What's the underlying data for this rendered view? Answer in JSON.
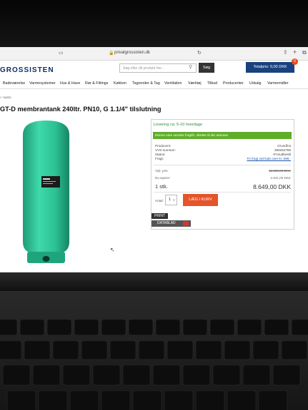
{
  "browser": {
    "url": "privatgrossisten.dk"
  },
  "header": {
    "logo": "GROSSISTEN",
    "search_placeholder": "Søg efter dit produkt her...",
    "search_button": "Søg",
    "cart_label": "Totalpris: 0,00 DKK",
    "cart_count": "0"
  },
  "nav": {
    "items": [
      "Badeværelse",
      "Varmesystemer",
      "Hus & Have",
      "Rør & Fittings",
      "Køkken",
      "Tagrender & Tag",
      "Ventilation",
      "Værktøj",
      "Tilbud",
      "Producenter",
      "Udsalg",
      "Varmemidler"
    ]
  },
  "breadcrumb": "< Hjælp",
  "product": {
    "title": "GT-D membrantank 240ltr. PN10, G 1.1/4\" tilslutning",
    "delivery": "Levering ca: 5-10 hverdage",
    "shipping_notice": "Denne vare sendes fragtfri, direkte til din adresse",
    "details": [
      {
        "label": "Producent:",
        "value": "Grundfos"
      },
      {
        "label": "VVS-nummer:",
        "value": "398254786"
      },
      {
        "label": "Status:",
        "value": "<Forudbestil"
      },
      {
        "label": "Fragt:",
        "value": "Fri fragt ved køb over kr. 599,-"
      }
    ],
    "list_price_label": "Vejl. pris:",
    "list_price": "11.500,00 DKK",
    "savings_label": "Du sparer:",
    "savings": "2.941,00 DKK",
    "unit": "1 stk.",
    "price": "8.649,00 DKK",
    "qty_label": "Antal:",
    "qty": "1",
    "add_to_cart": "LÆG I KURV",
    "print": "PRINT",
    "datasheet": "DATABLAD"
  },
  "colors": {
    "brand": "#0b2f66",
    "tank": "#2fc79a",
    "add_to_cart": "#e5542a",
    "shipping": "#5fae2a"
  }
}
